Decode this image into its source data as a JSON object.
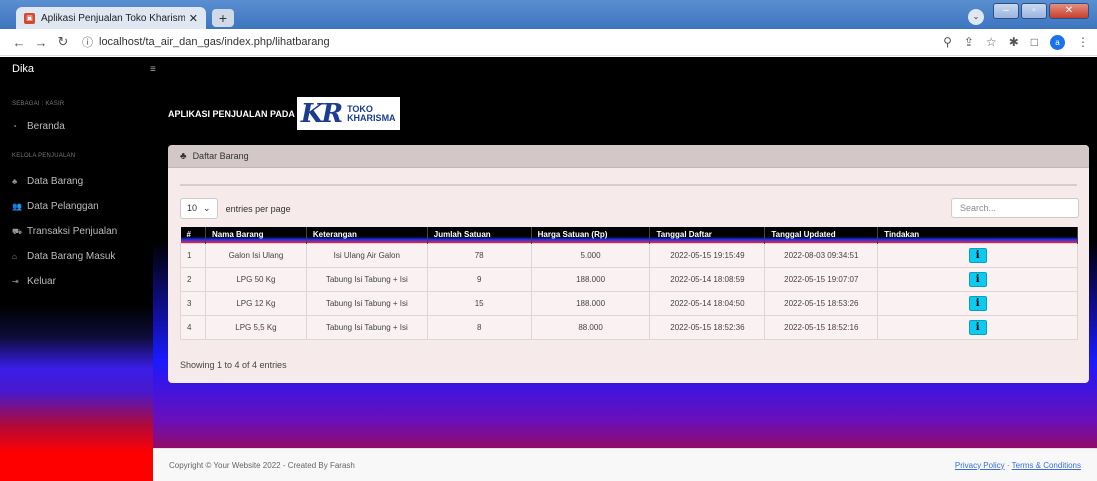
{
  "browser": {
    "tab_title": "Aplikasi Penjualan Toko Kharisma",
    "url": "localhost/ta_air_dan_gas/index.php/lihatbarang",
    "avatar_letter": "a"
  },
  "navbar": {
    "brand": "Dika",
    "toggle": "≡"
  },
  "sidebar": {
    "heading1": "SEBAGAI : KASIR",
    "beranda": "Beranda",
    "heading2": "KELOLA PENJUALAN",
    "items": [
      {
        "label": "Data Barang",
        "icon": "boxes-icon"
      },
      {
        "label": "Data Pelanggan",
        "icon": "users-icon"
      },
      {
        "label": "Transaksi Penjualan",
        "icon": "cart-icon"
      },
      {
        "label": "Data Barang Masuk",
        "icon": "warehouse-icon"
      },
      {
        "label": "Keluar",
        "icon": "logout-icon"
      }
    ]
  },
  "header": {
    "title": "APLIKASI PENJUALAN PADA",
    "logo_mark": "KR",
    "logo_line1": "TOKO",
    "logo_line2": "KHARISMA"
  },
  "card": {
    "title": "Daftar Barang",
    "per_page_value": "10",
    "per_page_label": "entries per page",
    "search_placeholder": "Search...",
    "showing": "Showing 1 to 4 of 4 entries"
  },
  "table": {
    "columns": [
      "#",
      "Nama Barang",
      "Keterangan",
      "Jumlah Satuan",
      "Harga Satuan (Rp)",
      "Tanggal Daftar",
      "Tanggal Updated",
      "Tindakan"
    ],
    "rows": [
      [
        "1",
        "Galon Isi Ulang",
        "Isi Ulang Air Galon",
        "78",
        "5.000",
        "2022-05-15 19:15:49",
        "2022-08-03 09:34:51"
      ],
      [
        "2",
        "LPG 50 Kg",
        "Tabung Isi Tabung + Isi",
        "9",
        "188.000",
        "2022-05-14 18:08:59",
        "2022-05-15 19:07:07"
      ],
      [
        "3",
        "LPG 12 Kg",
        "Tabung Isi Tabung + Isi",
        "15",
        "188.000",
        "2022-05-14 18:04:50",
        "2022-05-15 18:53:26"
      ],
      [
        "4",
        "LPG 5,5 Kg",
        "Tabung Isi Tabung + Isi",
        "8",
        "88.000",
        "2022-05-15 18:52:36",
        "2022-05-15 18:52:16"
      ]
    ],
    "action_label": "i"
  },
  "footer": {
    "copyright": "Copyright © Your Website 2022 - Created By Farash",
    "privacy": "Privacy Policy",
    "sep": "·",
    "terms": "Terms & Conditions"
  }
}
